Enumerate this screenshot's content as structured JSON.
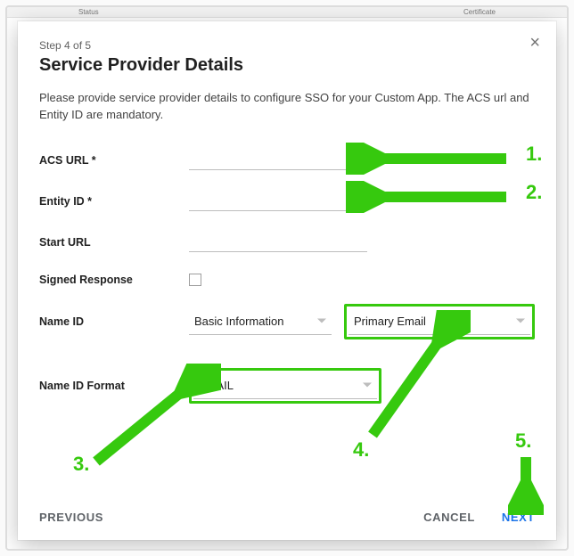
{
  "step_text": "Step 4 of 5",
  "title": "Service Provider Details",
  "description": "Please provide service provider details to configure SSO for your Custom App. The ACS url and Entity ID are mandatory.",
  "fields": {
    "acs_url": {
      "label": "ACS URL *",
      "value": ""
    },
    "entity_id": {
      "label": "Entity ID *",
      "value": ""
    },
    "start_url": {
      "label": "Start URL",
      "value": ""
    },
    "signed_response": {
      "label": "Signed Response",
      "checked": false
    },
    "name_id": {
      "label": "Name ID",
      "select1": "Basic Information",
      "select2": "Primary Email"
    },
    "name_id_format": {
      "label": "Name ID Format",
      "select": "EMAIL"
    }
  },
  "footer": {
    "previous": "PREVIOUS",
    "cancel": "CANCEL",
    "next": "NEXT"
  },
  "annotations": {
    "n1": "1.",
    "n2": "2.",
    "n3": "3.",
    "n4": "4.",
    "n5": "5."
  },
  "bg": {
    "left": "Status",
    "right": "Certificate"
  }
}
